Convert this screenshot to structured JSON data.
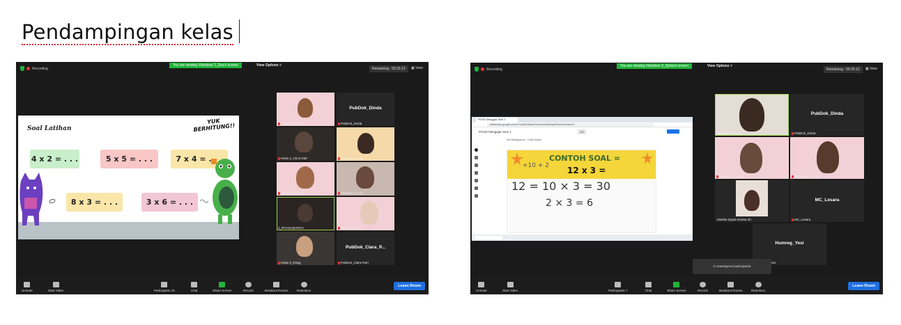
{
  "doc": {
    "title": "Pendampingan kelas"
  },
  "left": {
    "recording": "Recording",
    "viewing": "You are viewing Volunteer 2_Dea's screen",
    "view_options": "View Options ˅",
    "remaining": "Remaining : 00:25:13",
    "view": "View",
    "slide": {
      "title": "Soal Latihan",
      "yuk": "YUK",
      "berhitung": "BERHITUNG!!",
      "cards": [
        "4 x 2 = . . .",
        "5 x 5 = . . .",
        "7 x 4 = . . .",
        "8 x 3 = . . .",
        "3 x 6 = . . ."
      ]
    },
    "tiles": [
      {
        "label": "Perkas_Liandini",
        "type": "video"
      },
      {
        "label": "PubDok_Dinda",
        "name": "PubDok_Dinda",
        "type": "name"
      },
      {
        "label": "Kelas 2_Abi & Dafi",
        "type": "video"
      },
      {
        "label": "Volunteer 2_Ino",
        "type": "video"
      },
      {
        "label": "Volunteer 2_Dea",
        "type": "video"
      },
      {
        "label": "Volunteer 2_Citi",
        "type": "video"
      },
      {
        "label": "2_IRVANABARGA",
        "type": "video"
      },
      {
        "label": "Sceria_Kezia",
        "type": "video"
      },
      {
        "label": "Kelas 2_Rizqy",
        "type": "video"
      },
      {
        "label": "PubDok_Clara Putri",
        "name": "PubDok_Clara_P...",
        "type": "name"
      }
    ],
    "toolbar": {
      "unmute": "Unmute",
      "start_video": "Start Video",
      "participants": "Participants",
      "participants_count": "10",
      "chat": "Chat",
      "share_screen": "Share Screen",
      "record": "Record",
      "breakout": "Breakout Rooms",
      "reactions": "Reactions",
      "leave": "Leave Room"
    }
  },
  "right": {
    "recording": "Recording",
    "viewing": "You are viewing Volunteer 3_Sylvia's screen",
    "view_options": "View Options ˅",
    "remaining": "Remaining : 00:25:12",
    "view": "View",
    "browser": {
      "tab": "PGSD Mengajar Sesi 1",
      "url": "whiteboard.google.com/d/1Tqs9KEzBkqPNstuiOvwGMtAtapRKuktGUw/view?l",
      "app_title": "PGSD Mengajar Sesi 1",
      "set_background": "Set background",
      "clear_frame": "Clear frame",
      "frame": "1/3",
      "contoh": "CONTOH SOAL =",
      "expr": "12 x 3  =",
      "hand1": "12 = 10 × 3 = 30",
      "hand2": "2 × 3 = 6",
      "hand3": "+10 + 2"
    },
    "tiles": [
      {
        "label": "Volunteer 3_Sylvia",
        "type": "video"
      },
      {
        "label": "PubDok_Dinda",
        "name": "PubDok_Dinda",
        "type": "name"
      },
      {
        "label": "Volunteer 3_Juan",
        "type": "video"
      },
      {
        "label": "Volunteer 3_Tessa",
        "type": "video"
      },
      {
        "label": "Adeeba Qayla Erwina 3C",
        "type": "video"
      },
      {
        "label": "MC_Lesara",
        "name": "MC_Lesara",
        "type": "name"
      },
      {
        "label": "Humreg_Yesi",
        "name": "Humreg_Yesi",
        "type": "name"
      }
    ],
    "unassigned": "3 unassigned participants",
    "toolbar": {
      "unmute": "Unmute",
      "start_video": "Start Video",
      "participants": "Participants",
      "participants_count": "7",
      "chat": "Chat",
      "share_screen": "Share Screen",
      "record": "Record",
      "breakout": "Breakout Rooms",
      "reactions": "Reactions",
      "leave": "Leave Room"
    }
  }
}
